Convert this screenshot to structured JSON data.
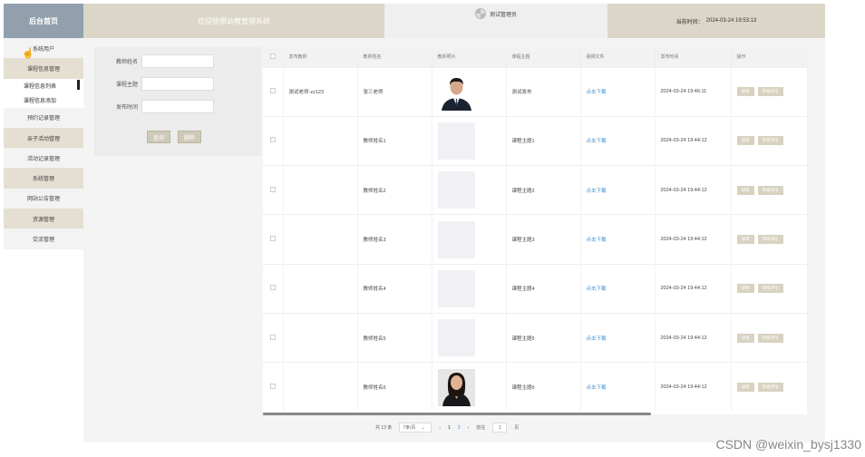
{
  "header": {
    "home": "后台首页",
    "title": "欢迎使用幼教管理系统",
    "user": "测试管理员",
    "time_label": "当前时间：",
    "time_value": "2024-03-24 19:53:13"
  },
  "sidebar": {
    "items": [
      {
        "label": "系统用户",
        "style": "light"
      },
      {
        "label": "课程信息管理",
        "style": "beige"
      },
      {
        "label": "课程信息列表",
        "style": "sub",
        "active": true
      },
      {
        "label": "课程信息添加",
        "style": "sub"
      },
      {
        "label": "预约记录管理",
        "style": "light"
      },
      {
        "label": "亲子活动管理",
        "style": "beige"
      },
      {
        "label": "活动记录管理",
        "style": "light"
      },
      {
        "label": "系统管理",
        "style": "beige"
      },
      {
        "label": "网站公告管理",
        "style": "light"
      },
      {
        "label": "资源管理",
        "style": "beige"
      },
      {
        "label": "交流管理",
        "style": "light"
      }
    ]
  },
  "search": {
    "teacher_name_label": "教师姓名",
    "course_topic_label": "课程主题",
    "publish_time_label": "发布时间",
    "search_button": "查询",
    "delete_button": "删除"
  },
  "table": {
    "headers": [
      "发布教师",
      "教师姓名",
      "教师照片",
      "课程主题",
      "视频文件",
      "发布时间",
      "操作"
    ],
    "rows": [
      {
        "publisher": "测试老师-zz123",
        "name": "张三老师",
        "topic": "测试发布",
        "file": "点击下载",
        "time": "2024-03-24 19:46:11",
        "photo": "male"
      },
      {
        "publisher": "",
        "name": "教师姓名1",
        "topic": "课程主题1",
        "file": "点击下载",
        "time": "2024-03-24 19:44:12",
        "photo": "blank"
      },
      {
        "publisher": "",
        "name": "教师姓名2",
        "topic": "课程主题2",
        "file": "点击下载",
        "time": "2024-03-24 19:44:12",
        "photo": "blank"
      },
      {
        "publisher": "",
        "name": "教师姓名3",
        "topic": "课程主题3",
        "file": "点击下载",
        "time": "2024-03-24 19:44:12",
        "photo": "blank"
      },
      {
        "publisher": "",
        "name": "教师姓名4",
        "topic": "课程主题4",
        "file": "点击下载",
        "time": "2024-03-24 19:44:12",
        "photo": "blank"
      },
      {
        "publisher": "",
        "name": "教师姓名5",
        "topic": "课程主题5",
        "file": "点击下载",
        "time": "2024-03-24 19:44:12",
        "photo": "blank"
      },
      {
        "publisher": "",
        "name": "教师姓名6",
        "topic": "课程主题6",
        "file": "点击下载",
        "time": "2024-03-24 19:44:12",
        "photo": "female"
      }
    ],
    "op_edit": "详情",
    "op_delete": "审核评论"
  },
  "pager": {
    "total": "共 13 条",
    "page_size": "7条/页",
    "prev": "‹",
    "pages": [
      "1",
      "2"
    ],
    "current": "2",
    "next": "›",
    "goto_label": "前往",
    "goto_value": "1",
    "page_suffix": "页"
  },
  "watermark": "CSDN @weixin_bysj1330"
}
